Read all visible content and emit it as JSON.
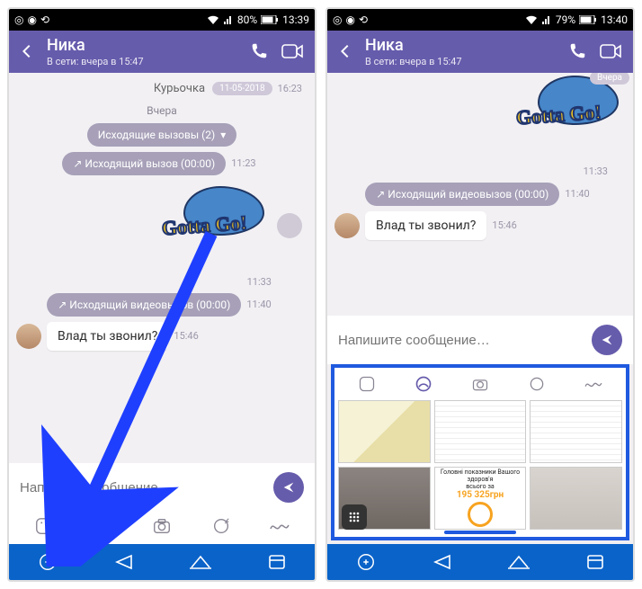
{
  "left": {
    "status": {
      "battery": "80%",
      "time": "13:39"
    },
    "header": {
      "name": "Ника",
      "online": "В сети: вчера в 15:47"
    },
    "chat": {
      "prev_line": "Курьочка",
      "prev_time": "16:23",
      "date_pill": "11-05-2018",
      "day_label": "Вчера",
      "calls_pill": "Исходящие вызовы  (2)",
      "call_out_pill": "↗ Исходящий вызов  (00:00)",
      "call_out_time": "11:23",
      "sticker_text": "Gotta Go!",
      "sticker_time": "11:33",
      "video_out_pill": "↗ Исходящий видеовызов  (00:00)",
      "video_out_time": "11:40",
      "msg_text": "Влад ты звонил?",
      "msg_time": "15:46"
    },
    "compose": {
      "placeholder": "Напишите сообщение…"
    }
  },
  "right": {
    "status": {
      "battery": "79%",
      "time": "13:40"
    },
    "header": {
      "name": "Ника",
      "online": "В сети: вчера в 15:47"
    },
    "chat": {
      "day_pill": "Вчера",
      "sticker_text": "Gotta Go!",
      "sticker_time": "11:33",
      "video_out_pill": "↗ Исходящий видеовызов  (00:00)",
      "video_out_time": "11:40",
      "msg_text": "Влад ты звонил?",
      "msg_time": "15:46"
    },
    "compose": {
      "placeholder": "Напишите сообщение…"
    },
    "gallery": {
      "ad_line1": "Головні показники Вашого здоров'я",
      "ad_price": "195 325грн",
      "ad_line2": "всього за"
    }
  }
}
